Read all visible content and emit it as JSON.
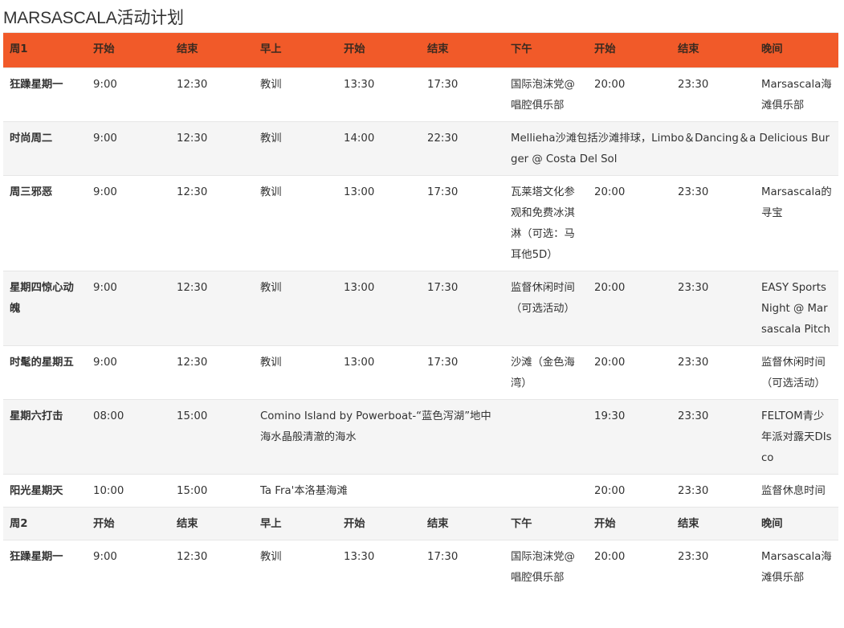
{
  "page": {
    "title": "MARSASCALA活动计划"
  },
  "header": [
    "周1",
    "开始",
    "结束",
    "早上",
    "开始",
    "结束",
    "下午",
    "开始",
    "结束",
    "晚间"
  ],
  "rows": [
    {
      "type": "row",
      "alt": false,
      "cells": [
        {
          "text": "狂躁星期一",
          "span": 1
        },
        {
          "text": "9:00",
          "span": 1
        },
        {
          "text": "12:30",
          "span": 1
        },
        {
          "text": "教训",
          "span": 1
        },
        {
          "text": "13:30",
          "span": 1
        },
        {
          "text": "17:30",
          "span": 1
        },
        {
          "text": "国际泡沫党@唱腔俱乐部",
          "span": 1
        },
        {
          "text": "20:00",
          "span": 1
        },
        {
          "text": "23:30",
          "span": 1
        },
        {
          "text": "Marsascala海滩俱乐部",
          "span": 1
        }
      ]
    },
    {
      "type": "row",
      "alt": true,
      "cells": [
        {
          "text": "时尚周二",
          "span": 1
        },
        {
          "text": "9:00",
          "span": 1
        },
        {
          "text": "12:30",
          "span": 1
        },
        {
          "text": "教训",
          "span": 1
        },
        {
          "text": "14:00",
          "span": 1
        },
        {
          "text": "22:30",
          "span": 1
        },
        {
          "text": "Mellieha沙滩包括沙滩排球，Limbo＆Dancing＆a Delicious Burger @ Costa Del Sol",
          "span": 4
        }
      ]
    },
    {
      "type": "row",
      "alt": false,
      "cells": [
        {
          "text": "周三邪恶",
          "span": 1
        },
        {
          "text": "9:00",
          "span": 1
        },
        {
          "text": "12:30",
          "span": 1
        },
        {
          "text": "教训",
          "span": 1
        },
        {
          "text": "13:00",
          "span": 1
        },
        {
          "text": "17:30",
          "span": 1
        },
        {
          "text": "瓦莱塔文化参观和免费冰淇淋（可选：马耳他5D）",
          "span": 1
        },
        {
          "text": "20:00",
          "span": 1
        },
        {
          "text": "23:30",
          "span": 1
        },
        {
          "text": "Marsascala的寻宝",
          "span": 1
        }
      ]
    },
    {
      "type": "row",
      "alt": true,
      "cells": [
        {
          "text": "星期四惊心动魄",
          "span": 1
        },
        {
          "text": "9:00",
          "span": 1
        },
        {
          "text": "12:30",
          "span": 1
        },
        {
          "text": "教训",
          "span": 1
        },
        {
          "text": "13:00",
          "span": 1
        },
        {
          "text": "17:30",
          "span": 1
        },
        {
          "text": "监督休闲时间（可选活动）",
          "span": 1
        },
        {
          "text": "20:00",
          "span": 1
        },
        {
          "text": "23:30",
          "span": 1
        },
        {
          "text": "EASY Sports Night @ Marsascala Pitch",
          "span": 1
        }
      ]
    },
    {
      "type": "row",
      "alt": false,
      "cells": [
        {
          "text": "时髦的星期五",
          "span": 1
        },
        {
          "text": "9:00",
          "span": 1
        },
        {
          "text": "12:30",
          "span": 1
        },
        {
          "text": "教训",
          "span": 1
        },
        {
          "text": "13:00",
          "span": 1
        },
        {
          "text": "17:30",
          "span": 1
        },
        {
          "text": "沙滩（金色海湾）",
          "span": 1
        },
        {
          "text": "20:00",
          "span": 1
        },
        {
          "text": "23:30",
          "span": 1
        },
        {
          "text": "监督休闲时间（可选活动）",
          "span": 1
        }
      ]
    },
    {
      "type": "row",
      "alt": true,
      "cells": [
        {
          "text": "星期六打击",
          "span": 1
        },
        {
          "text": "08:00",
          "span": 1
        },
        {
          "text": "15:00",
          "span": 1
        },
        {
          "text": "Comino Island by Powerboat-“蓝色泻湖”地中海水晶般清澈的海水",
          "span": 3
        },
        {
          "text": "",
          "span": 1
        },
        {
          "text": "19:30",
          "span": 1
        },
        {
          "text": "23:30",
          "span": 1
        },
        {
          "text": "FELTOM青少年派对露天DIsco",
          "span": 1
        }
      ]
    },
    {
      "type": "row",
      "alt": false,
      "cells": [
        {
          "text": "阳光星期天",
          "span": 1
        },
        {
          "text": "10:00",
          "span": 1
        },
        {
          "text": "15:00",
          "span": 1
        },
        {
          "text": "Ta Fra'本洛基海滩",
          "span": 3
        },
        {
          "text": "",
          "span": 1
        },
        {
          "text": "20:00",
          "span": 1
        },
        {
          "text": "23:30",
          "span": 1
        },
        {
          "text": "监督休息时间",
          "span": 1
        }
      ]
    },
    {
      "type": "subhead",
      "alt": true,
      "cells": [
        {
          "text": "周2",
          "span": 1
        },
        {
          "text": "开始",
          "span": 1
        },
        {
          "text": "结束",
          "span": 1
        },
        {
          "text": "早上",
          "span": 1
        },
        {
          "text": "开始",
          "span": 1
        },
        {
          "text": "结束",
          "span": 1
        },
        {
          "text": "下午",
          "span": 1
        },
        {
          "text": "开始",
          "span": 1
        },
        {
          "text": "结束",
          "span": 1
        },
        {
          "text": "晚间",
          "span": 1
        }
      ]
    },
    {
      "type": "row",
      "alt": false,
      "cells": [
        {
          "text": "狂躁星期一",
          "span": 1
        },
        {
          "text": "9:00",
          "span": 1
        },
        {
          "text": "12:30",
          "span": 1
        },
        {
          "text": "教训",
          "span": 1
        },
        {
          "text": "13:30",
          "span": 1
        },
        {
          "text": "17:30",
          "span": 1
        },
        {
          "text": "国际泡沫党@唱腔俱乐部",
          "span": 1
        },
        {
          "text": "20:00",
          "span": 1
        },
        {
          "text": "23:30",
          "span": 1
        },
        {
          "text": "Marsascala海滩俱乐部",
          "span": 1
        }
      ]
    }
  ]
}
